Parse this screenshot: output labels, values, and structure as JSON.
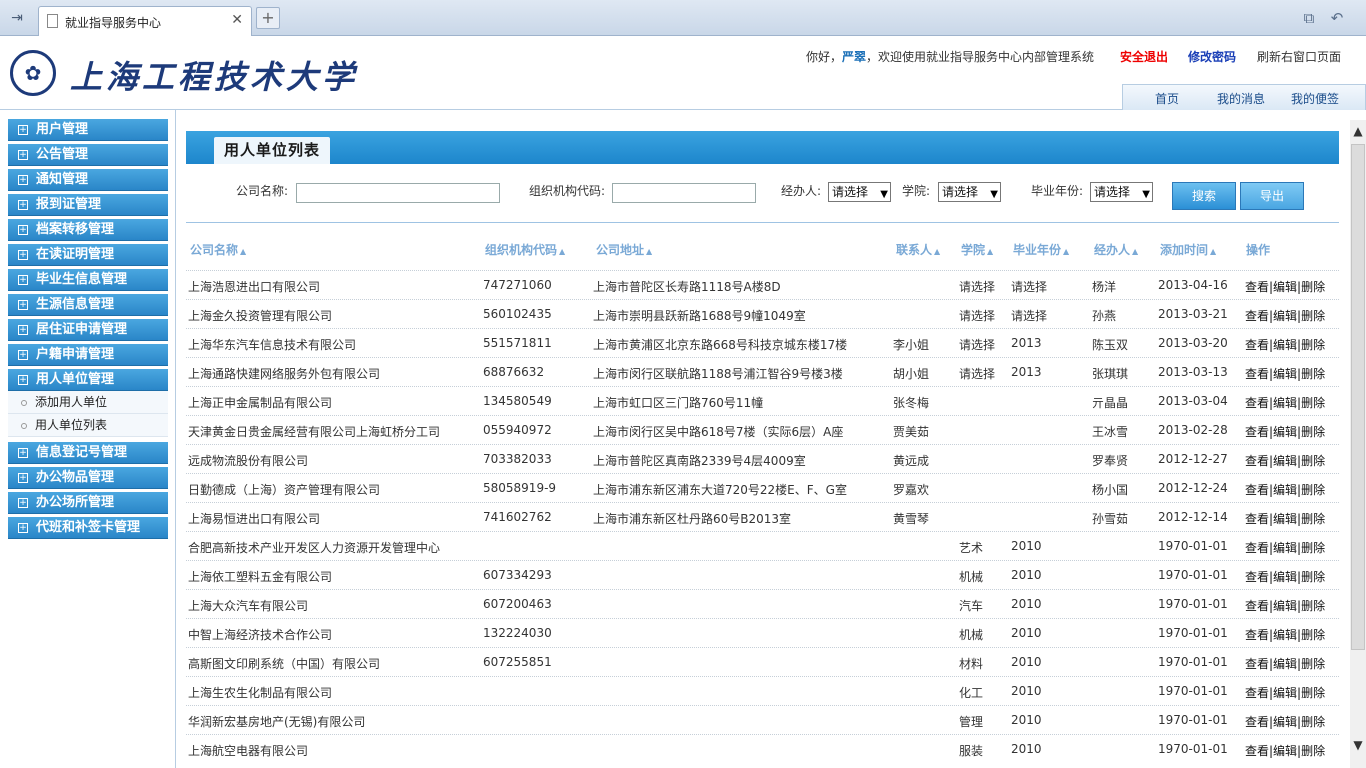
{
  "browser": {
    "tab_title": "就业指导服务中心",
    "close": "✕",
    "new_tab": "+"
  },
  "header": {
    "logo_text": "上海工程技术大学",
    "greeting_prefix": "你好，",
    "user": "严翠",
    "greeting_suffix": "，欢迎使用就业指导服务中心内部管理系统",
    "logout": "安全退出",
    "change_password": "修改密码",
    "refresh": "刷新右窗口页面",
    "tabs": [
      "首页",
      "我的消息",
      "我的便签"
    ]
  },
  "sidebar": {
    "items": [
      "用户管理",
      "公告管理",
      "通知管理",
      "报到证管理",
      "档案转移管理",
      "在读证明管理",
      "毕业生信息管理",
      "生源信息管理",
      "居住证申请管理",
      "户籍申请管理",
      "用人单位管理"
    ],
    "subitems": [
      "添加用人单位",
      "用人单位列表"
    ],
    "items_after": [
      "信息登记号管理",
      "办公物品管理",
      "办公场所管理",
      "代班和补签卡管理"
    ]
  },
  "page": {
    "title": "用人单位列表",
    "filters": {
      "company_label": "公司名称:",
      "org_code_label": "组织机构代码:",
      "agent_label": "经办人:",
      "agent_value": "请选择",
      "college_label": "学院:",
      "college_value": "请选择",
      "year_label": "毕业年份:",
      "year_value": "请选择",
      "search": "搜索",
      "export": "导出"
    },
    "columns": [
      "公司名称",
      "组织机构代码",
      "公司地址",
      "联系人",
      "学院",
      "毕业年份",
      "经办人",
      "添加时间",
      "操作"
    ],
    "ops": "查看|编辑|删除",
    "rows": [
      {
        "name": "上海浩恩进出口有限公司",
        "code": "747271060",
        "addr": "上海市普陀区长寿路1118号A楼8D",
        "contact": "",
        "college": "请选择",
        "year": "请选择",
        "agent": "杨洋",
        "date": "2013-04-16"
      },
      {
        "name": "上海金久投资管理有限公司",
        "code": "560102435",
        "addr": "上海市崇明县跃新路1688号9幢1049室",
        "contact": "",
        "college": "请选择",
        "year": "请选择",
        "agent": "孙燕",
        "date": "2013-03-21"
      },
      {
        "name": "上海华东汽车信息技术有限公司",
        "code": "551571811",
        "addr": "上海市黄浦区北京东路668号科技京城东楼17楼",
        "contact": "李小姐",
        "college": "请选择",
        "year": "2013",
        "agent": "陈玉双",
        "date": "2013-03-20"
      },
      {
        "name": "上海通路快建网络服务外包有限公司",
        "code": "68876632",
        "addr": "上海市闵行区联航路1188号浦江智谷9号楼3楼",
        "contact": "胡小姐",
        "college": "请选择",
        "year": "2013",
        "agent": "张琪琪",
        "date": "2013-03-13"
      },
      {
        "name": "上海正申金属制品有限公司",
        "code": "134580549",
        "addr": "上海市虹口区三门路760号11幢",
        "contact": "张冬梅",
        "college": "",
        "year": "",
        "agent": "亓晶晶",
        "date": "2013-03-04"
      },
      {
        "name": "天津黄金日贵金属经营有限公司上海虹桥分工司",
        "code": "055940972",
        "addr": "上海市闵行区吴中路618号7楼（实际6层）A座",
        "contact": "贾美茹",
        "college": "",
        "year": "",
        "agent": "王冰雪",
        "date": "2013-02-28"
      },
      {
        "name": "远成物流股份有限公司",
        "code": "703382033",
        "addr": "上海市普陀区真南路2339号4层4009室",
        "contact": "黄远成",
        "college": "",
        "year": "",
        "agent": "罗奉贤",
        "date": "2012-12-27"
      },
      {
        "name": "日勤德成（上海）资产管理有限公司",
        "code": "58058919-9",
        "addr": "上海市浦东新区浦东大道720号22楼E、F、G室",
        "contact": "罗嘉欢",
        "college": "",
        "year": "",
        "agent": "杨小国",
        "date": "2012-12-24"
      },
      {
        "name": "上海易恒进出口有限公司",
        "code": "741602762",
        "addr": "上海市浦东新区杜丹路60号B2013室",
        "contact": "黄雪琴",
        "college": "",
        "year": "",
        "agent": "孙雪茹",
        "date": "2012-12-14"
      },
      {
        "name": "合肥高新技术产业开发区人力资源开发管理中心",
        "code": "",
        "addr": "",
        "contact": "",
        "college": "艺术",
        "year": "2010",
        "agent": "",
        "date": "1970-01-01"
      },
      {
        "name": "上海依工塑料五金有限公司",
        "code": "607334293",
        "addr": "",
        "contact": "",
        "college": "机械",
        "year": "2010",
        "agent": "",
        "date": "1970-01-01"
      },
      {
        "name": "上海大众汽车有限公司",
        "code": "607200463",
        "addr": "",
        "contact": "",
        "college": "汽车",
        "year": "2010",
        "agent": "",
        "date": "1970-01-01"
      },
      {
        "name": "中智上海经济技术合作公司",
        "code": "132224030",
        "addr": "",
        "contact": "",
        "college": "机械",
        "year": "2010",
        "agent": "",
        "date": "1970-01-01"
      },
      {
        "name": "高斯图文印刷系统（中国）有限公司",
        "code": "607255851",
        "addr": "",
        "contact": "",
        "college": "材料",
        "year": "2010",
        "agent": "",
        "date": "1970-01-01"
      },
      {
        "name": "上海生农生化制品有限公司",
        "code": "",
        "addr": "",
        "contact": "",
        "college": "化工",
        "year": "2010",
        "agent": "",
        "date": "1970-01-01"
      },
      {
        "name": "华润新宏基房地产(无锡)有限公司",
        "code": "",
        "addr": "",
        "contact": "",
        "college": "管理",
        "year": "2010",
        "agent": "",
        "date": "1970-01-01"
      },
      {
        "name": "上海航空电器有限公司",
        "code": "",
        "addr": "",
        "contact": "",
        "college": "服装",
        "year": "2010",
        "agent": "",
        "date": "1970-01-01"
      }
    ]
  }
}
